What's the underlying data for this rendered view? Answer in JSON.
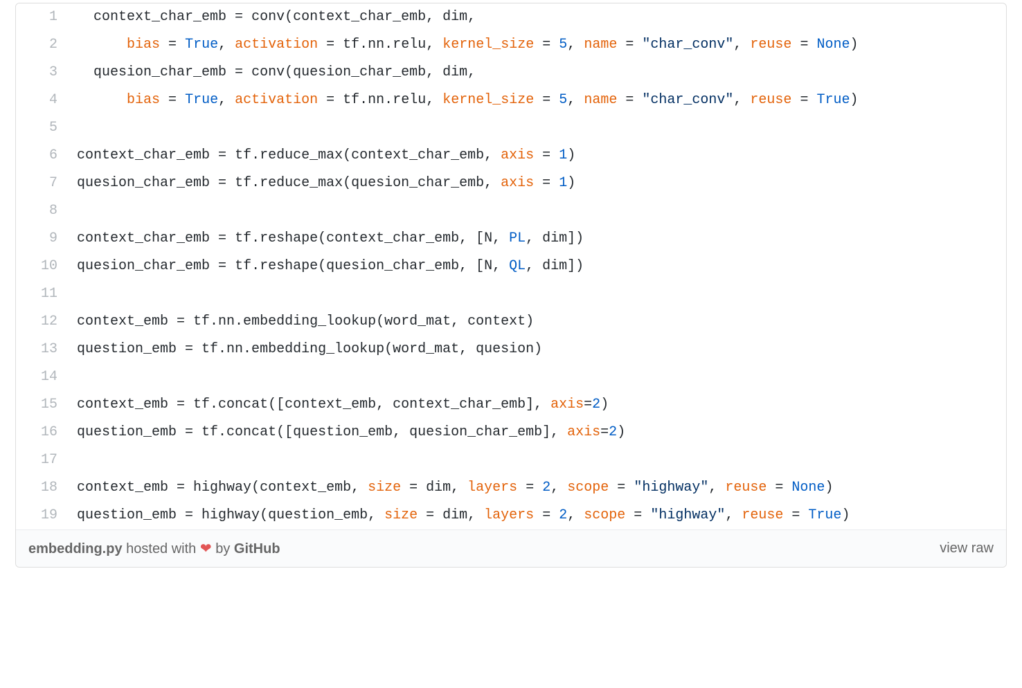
{
  "colors": {
    "default": "#24292e",
    "keyword_param": "#e36209",
    "constant": "#005cc5",
    "string": "#032f62",
    "lineno": "#b1b6bb",
    "footer_text": "#666",
    "heart": "#e25555"
  },
  "footer": {
    "filename": "embedding.py",
    "hosted_with": " hosted with ",
    "by": " by ",
    "github": "GitHub",
    "heart": "❤",
    "view_raw": "view raw"
  },
  "lines": [
    {
      "n": "1",
      "tokens": [
        {
          "t": "  context_char_emb ",
          "c": "default"
        },
        {
          "t": "=",
          "c": "default"
        },
        {
          "t": " conv(context_char_emb, dim,",
          "c": "default"
        }
      ]
    },
    {
      "n": "2",
      "tokens": [
        {
          "t": "      ",
          "c": "default"
        },
        {
          "t": "bias",
          "c": "keyword_param"
        },
        {
          "t": " ",
          "c": "default"
        },
        {
          "t": "=",
          "c": "default"
        },
        {
          "t": " ",
          "c": "default"
        },
        {
          "t": "True",
          "c": "constant"
        },
        {
          "t": ", ",
          "c": "default"
        },
        {
          "t": "activation",
          "c": "keyword_param"
        },
        {
          "t": " ",
          "c": "default"
        },
        {
          "t": "=",
          "c": "default"
        },
        {
          "t": " tf.nn.relu, ",
          "c": "default"
        },
        {
          "t": "kernel_size",
          "c": "keyword_param"
        },
        {
          "t": " ",
          "c": "default"
        },
        {
          "t": "=",
          "c": "default"
        },
        {
          "t": " ",
          "c": "default"
        },
        {
          "t": "5",
          "c": "constant"
        },
        {
          "t": ", ",
          "c": "default"
        },
        {
          "t": "name",
          "c": "keyword_param"
        },
        {
          "t": " ",
          "c": "default"
        },
        {
          "t": "=",
          "c": "default"
        },
        {
          "t": " ",
          "c": "default"
        },
        {
          "t": "\"char_conv\"",
          "c": "string"
        },
        {
          "t": ", ",
          "c": "default"
        },
        {
          "t": "reuse",
          "c": "keyword_param"
        },
        {
          "t": " ",
          "c": "default"
        },
        {
          "t": "=",
          "c": "default"
        },
        {
          "t": " ",
          "c": "default"
        },
        {
          "t": "None",
          "c": "constant"
        },
        {
          "t": ")",
          "c": "default"
        }
      ]
    },
    {
      "n": "3",
      "tokens": [
        {
          "t": "  quesion_char_emb ",
          "c": "default"
        },
        {
          "t": "=",
          "c": "default"
        },
        {
          "t": " conv(quesion_char_emb, dim,",
          "c": "default"
        }
      ]
    },
    {
      "n": "4",
      "tokens": [
        {
          "t": "      ",
          "c": "default"
        },
        {
          "t": "bias",
          "c": "keyword_param"
        },
        {
          "t": " ",
          "c": "default"
        },
        {
          "t": "=",
          "c": "default"
        },
        {
          "t": " ",
          "c": "default"
        },
        {
          "t": "True",
          "c": "constant"
        },
        {
          "t": ", ",
          "c": "default"
        },
        {
          "t": "activation",
          "c": "keyword_param"
        },
        {
          "t": " ",
          "c": "default"
        },
        {
          "t": "=",
          "c": "default"
        },
        {
          "t": " tf.nn.relu, ",
          "c": "default"
        },
        {
          "t": "kernel_size",
          "c": "keyword_param"
        },
        {
          "t": " ",
          "c": "default"
        },
        {
          "t": "=",
          "c": "default"
        },
        {
          "t": " ",
          "c": "default"
        },
        {
          "t": "5",
          "c": "constant"
        },
        {
          "t": ", ",
          "c": "default"
        },
        {
          "t": "name",
          "c": "keyword_param"
        },
        {
          "t": " ",
          "c": "default"
        },
        {
          "t": "=",
          "c": "default"
        },
        {
          "t": " ",
          "c": "default"
        },
        {
          "t": "\"char_conv\"",
          "c": "string"
        },
        {
          "t": ", ",
          "c": "default"
        },
        {
          "t": "reuse",
          "c": "keyword_param"
        },
        {
          "t": " ",
          "c": "default"
        },
        {
          "t": "=",
          "c": "default"
        },
        {
          "t": " ",
          "c": "default"
        },
        {
          "t": "True",
          "c": "constant"
        },
        {
          "t": ")",
          "c": "default"
        }
      ]
    },
    {
      "n": "5",
      "tokens": [
        {
          "t": "",
          "c": "default"
        }
      ]
    },
    {
      "n": "6",
      "tokens": [
        {
          "t": "context_char_emb ",
          "c": "default"
        },
        {
          "t": "=",
          "c": "default"
        },
        {
          "t": " tf.reduce_max(context_char_emb, ",
          "c": "default"
        },
        {
          "t": "axis",
          "c": "keyword_param"
        },
        {
          "t": " ",
          "c": "default"
        },
        {
          "t": "=",
          "c": "default"
        },
        {
          "t": " ",
          "c": "default"
        },
        {
          "t": "1",
          "c": "constant"
        },
        {
          "t": ")",
          "c": "default"
        }
      ]
    },
    {
      "n": "7",
      "tokens": [
        {
          "t": "quesion_char_emb ",
          "c": "default"
        },
        {
          "t": "=",
          "c": "default"
        },
        {
          "t": " tf.reduce_max(quesion_char_emb, ",
          "c": "default"
        },
        {
          "t": "axis",
          "c": "keyword_param"
        },
        {
          "t": " ",
          "c": "default"
        },
        {
          "t": "=",
          "c": "default"
        },
        {
          "t": " ",
          "c": "default"
        },
        {
          "t": "1",
          "c": "constant"
        },
        {
          "t": ")",
          "c": "default"
        }
      ]
    },
    {
      "n": "8",
      "tokens": [
        {
          "t": "",
          "c": "default"
        }
      ]
    },
    {
      "n": "9",
      "tokens": [
        {
          "t": "context_char_emb ",
          "c": "default"
        },
        {
          "t": "=",
          "c": "default"
        },
        {
          "t": " tf.reshape(context_char_emb, [N, ",
          "c": "default"
        },
        {
          "t": "PL",
          "c": "constant"
        },
        {
          "t": ", dim])",
          "c": "default"
        }
      ]
    },
    {
      "n": "10",
      "tokens": [
        {
          "t": "quesion_char_emb ",
          "c": "default"
        },
        {
          "t": "=",
          "c": "default"
        },
        {
          "t": " tf.reshape(quesion_char_emb, [N, ",
          "c": "default"
        },
        {
          "t": "QL",
          "c": "constant"
        },
        {
          "t": ", dim])",
          "c": "default"
        }
      ]
    },
    {
      "n": "11",
      "tokens": [
        {
          "t": "",
          "c": "default"
        }
      ]
    },
    {
      "n": "12",
      "tokens": [
        {
          "t": "context_emb ",
          "c": "default"
        },
        {
          "t": "=",
          "c": "default"
        },
        {
          "t": " tf.nn.embedding_lookup(word_mat, context)",
          "c": "default"
        }
      ]
    },
    {
      "n": "13",
      "tokens": [
        {
          "t": "question_emb ",
          "c": "default"
        },
        {
          "t": "=",
          "c": "default"
        },
        {
          "t": " tf.nn.embedding_lookup(word_mat, quesion)",
          "c": "default"
        }
      ]
    },
    {
      "n": "14",
      "tokens": [
        {
          "t": "",
          "c": "default"
        }
      ]
    },
    {
      "n": "15",
      "tokens": [
        {
          "t": "context_emb ",
          "c": "default"
        },
        {
          "t": "=",
          "c": "default"
        },
        {
          "t": " tf.concat([context_emb, context_char_emb], ",
          "c": "default"
        },
        {
          "t": "axis",
          "c": "keyword_param"
        },
        {
          "t": "=",
          "c": "default"
        },
        {
          "t": "2",
          "c": "constant"
        },
        {
          "t": ")",
          "c": "default"
        }
      ]
    },
    {
      "n": "16",
      "tokens": [
        {
          "t": "question_emb ",
          "c": "default"
        },
        {
          "t": "=",
          "c": "default"
        },
        {
          "t": " tf.concat([question_emb, quesion_char_emb], ",
          "c": "default"
        },
        {
          "t": "axis",
          "c": "keyword_param"
        },
        {
          "t": "=",
          "c": "default"
        },
        {
          "t": "2",
          "c": "constant"
        },
        {
          "t": ")",
          "c": "default"
        }
      ]
    },
    {
      "n": "17",
      "tokens": [
        {
          "t": "",
          "c": "default"
        }
      ]
    },
    {
      "n": "18",
      "tokens": [
        {
          "t": "context_emb ",
          "c": "default"
        },
        {
          "t": "=",
          "c": "default"
        },
        {
          "t": " highway(context_emb, ",
          "c": "default"
        },
        {
          "t": "size",
          "c": "keyword_param"
        },
        {
          "t": " ",
          "c": "default"
        },
        {
          "t": "=",
          "c": "default"
        },
        {
          "t": " dim, ",
          "c": "default"
        },
        {
          "t": "layers",
          "c": "keyword_param"
        },
        {
          "t": " ",
          "c": "default"
        },
        {
          "t": "=",
          "c": "default"
        },
        {
          "t": " ",
          "c": "default"
        },
        {
          "t": "2",
          "c": "constant"
        },
        {
          "t": ", ",
          "c": "default"
        },
        {
          "t": "scope",
          "c": "keyword_param"
        },
        {
          "t": " ",
          "c": "default"
        },
        {
          "t": "=",
          "c": "default"
        },
        {
          "t": " ",
          "c": "default"
        },
        {
          "t": "\"highway\"",
          "c": "string"
        },
        {
          "t": ", ",
          "c": "default"
        },
        {
          "t": "reuse",
          "c": "keyword_param"
        },
        {
          "t": " ",
          "c": "default"
        },
        {
          "t": "=",
          "c": "default"
        },
        {
          "t": " ",
          "c": "default"
        },
        {
          "t": "None",
          "c": "constant"
        },
        {
          "t": ")",
          "c": "default"
        }
      ]
    },
    {
      "n": "19",
      "tokens": [
        {
          "t": "question_emb ",
          "c": "default"
        },
        {
          "t": "=",
          "c": "default"
        },
        {
          "t": " highway(question_emb, ",
          "c": "default"
        },
        {
          "t": "size",
          "c": "keyword_param"
        },
        {
          "t": " ",
          "c": "default"
        },
        {
          "t": "=",
          "c": "default"
        },
        {
          "t": " dim, ",
          "c": "default"
        },
        {
          "t": "layers",
          "c": "keyword_param"
        },
        {
          "t": " ",
          "c": "default"
        },
        {
          "t": "=",
          "c": "default"
        },
        {
          "t": " ",
          "c": "default"
        },
        {
          "t": "2",
          "c": "constant"
        },
        {
          "t": ", ",
          "c": "default"
        },
        {
          "t": "scope",
          "c": "keyword_param"
        },
        {
          "t": " ",
          "c": "default"
        },
        {
          "t": "=",
          "c": "default"
        },
        {
          "t": " ",
          "c": "default"
        },
        {
          "t": "\"highway\"",
          "c": "string"
        },
        {
          "t": ", ",
          "c": "default"
        },
        {
          "t": "reuse",
          "c": "keyword_param"
        },
        {
          "t": " ",
          "c": "default"
        },
        {
          "t": "=",
          "c": "default"
        },
        {
          "t": " ",
          "c": "default"
        },
        {
          "t": "True",
          "c": "constant"
        },
        {
          "t": ")",
          "c": "default"
        }
      ]
    }
  ]
}
